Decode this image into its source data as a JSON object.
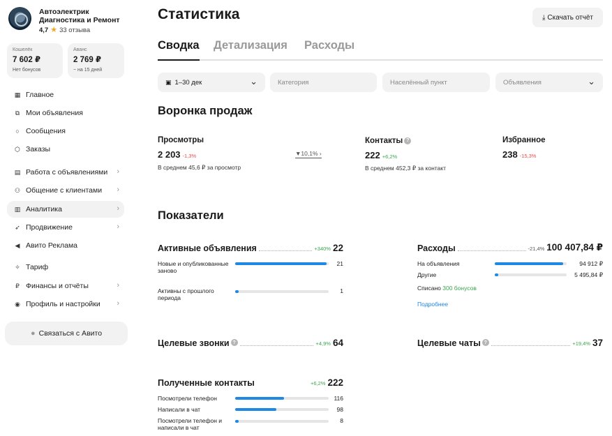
{
  "profile": {
    "name": "Автоэлектрик Диагностика и Ремонт",
    "rating": "4,7",
    "reviews": "33 отзыва"
  },
  "wallet": {
    "label": "Кошелёк",
    "value": "7 602 ₽",
    "sub": "Нет бонусов"
  },
  "advance": {
    "label": "Аванс",
    "value": "2 769 ₽",
    "sub": "~ на 15 дней"
  },
  "nav": [
    {
      "label": "Главное",
      "icon": "grid-icon"
    },
    {
      "label": "Мои объявления",
      "icon": "copy-icon"
    },
    {
      "label": "Сообщения",
      "icon": "chat-icon"
    },
    {
      "label": "Заказы",
      "icon": "box-icon"
    },
    {
      "label": "Работа с объявлениями",
      "icon": "doc-icon"
    },
    {
      "label": "Общение с клиентами",
      "icon": "people-icon"
    },
    {
      "label": "Аналитика",
      "icon": "chart-icon"
    },
    {
      "label": "Продвижение",
      "icon": "rocket-icon"
    },
    {
      "label": "Авито Реклама",
      "icon": "megaphone-icon"
    },
    {
      "label": "Тариф",
      "icon": "tariff-icon"
    },
    {
      "label": "Финансы и отчёты",
      "icon": "ruble-icon"
    },
    {
      "label": "Профиль и настройки",
      "icon": "profile-icon"
    }
  ],
  "contact_button": "Связаться с Авито",
  "page_title": "Статистика",
  "download_button": "Скачать отчёт",
  "tabs": [
    "Сводка",
    "Детализация",
    "Расходы"
  ],
  "filters": {
    "period": "1–30 дек",
    "category": "Категория",
    "locality": "Населённый пункт",
    "listings": "Объявления"
  },
  "funnel": {
    "title": "Воронка продаж",
    "views": {
      "label": "Просмотры",
      "value": "2 203",
      "delta": "-1,3%",
      "sub": "В среднем 45,6 ₽ за просмотр"
    },
    "conversion": "10,1%",
    "contacts": {
      "label": "Контакты",
      "value": "222",
      "delta": "+6,2%",
      "sub": "В среднем 452,3 ₽ за контакт"
    },
    "favorites": {
      "label": "Избранное",
      "value": "238",
      "delta": "-15,3%"
    }
  },
  "indicators": {
    "title": "Показатели",
    "active_listings": {
      "name": "Активные объявления",
      "delta": "+340%",
      "value": "22",
      "rows": [
        {
          "label": "Новые и опубликованные заново",
          "value": "21",
          "fraction": 0.98
        },
        {
          "label": "Активны с прошлого периода",
          "value": "1",
          "fraction": 0.04
        }
      ]
    },
    "expenses": {
      "name": "Расходы",
      "delta": "-21,4%",
      "value": "100 407,84 ₽",
      "rows": [
        {
          "label": "На объявления",
          "value": "94 912 ₽",
          "fraction": 0.95
        },
        {
          "label": "Другие",
          "value": "5 495,84 ₽",
          "fraction": 0.05
        }
      ],
      "bonus_prefix": "Списано",
      "bonus_link": "300 бонусов",
      "more": "Подробнее"
    },
    "target_calls": {
      "name": "Целевые звонки",
      "delta": "+4,9%",
      "value": "64"
    },
    "target_chats": {
      "name": "Целевые чаты",
      "delta": "+19,4%",
      "value": "37"
    },
    "received_contacts": {
      "name": "Полученные контакты",
      "delta": "+6,2%",
      "value": "222",
      "rows": [
        {
          "label": "Посмотрели телефон",
          "value": "116",
          "fraction": 0.52
        },
        {
          "label": "Написали в чат",
          "value": "98",
          "fraction": 0.44
        },
        {
          "label": "Посмотрели телефон и написали в чат",
          "value": "8",
          "fraction": 0.04
        }
      ]
    }
  },
  "colors": {
    "accent": "#1e88e5",
    "negative": "#e84a4a",
    "positive": "#3aa64c",
    "surface": "#f2f2f2"
  }
}
